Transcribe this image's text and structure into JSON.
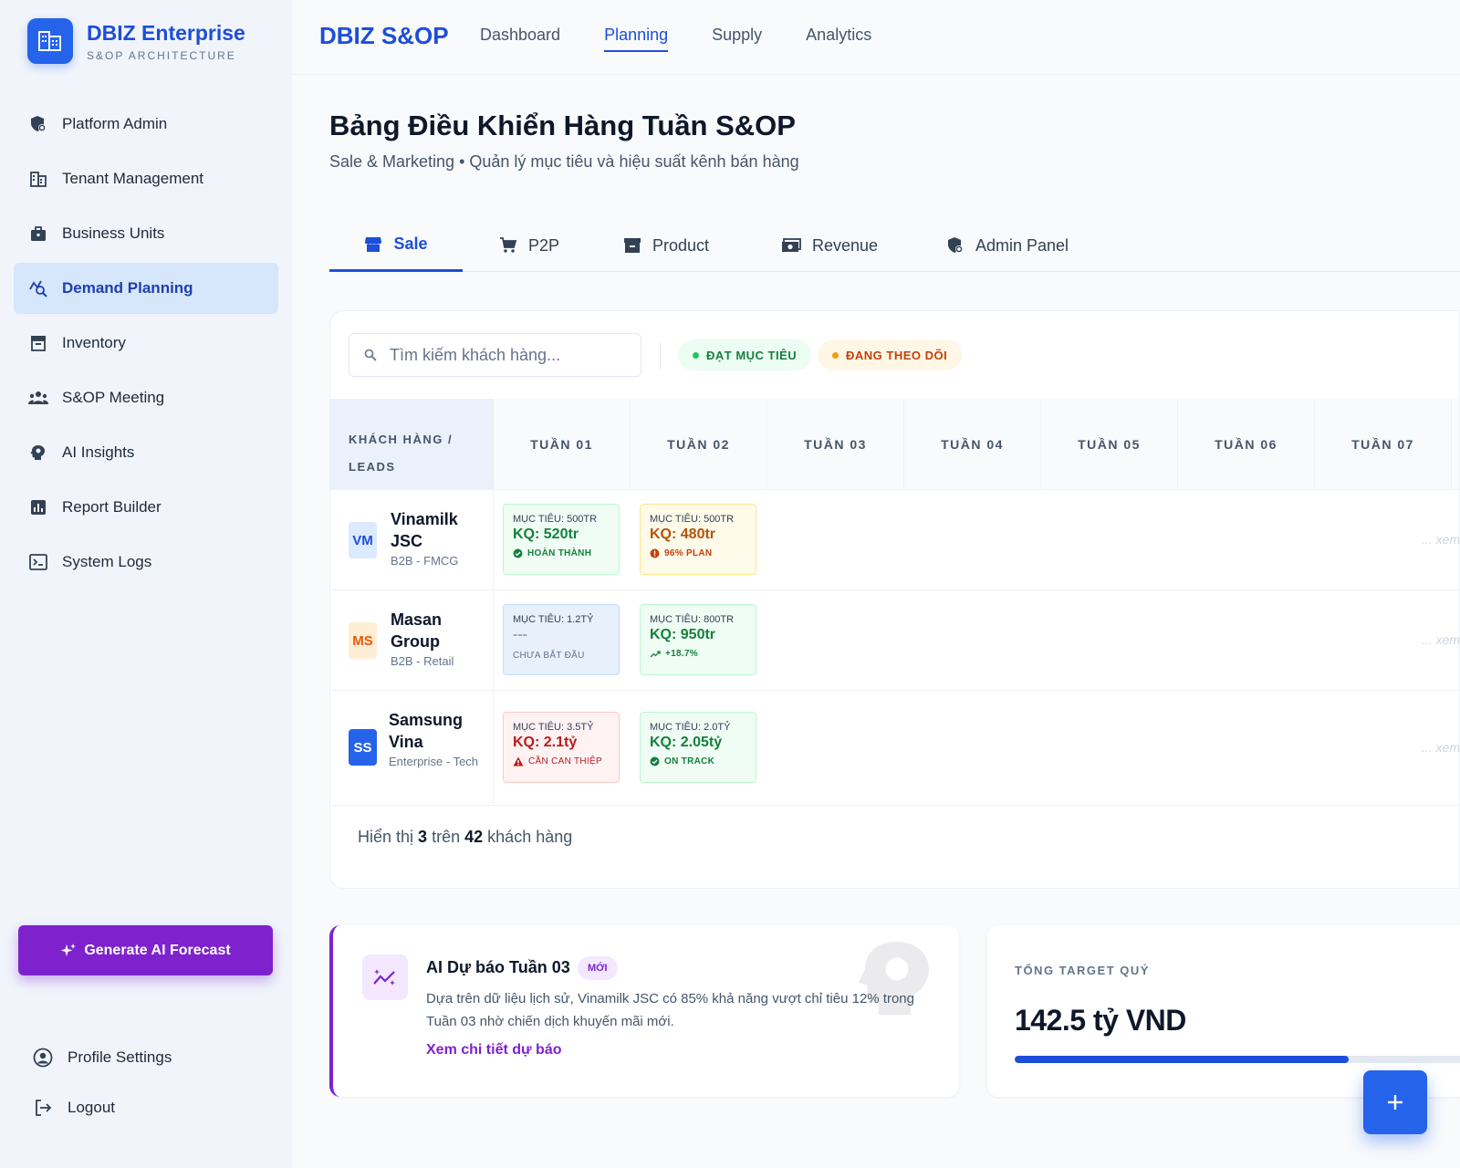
{
  "brand": {
    "title": "DBIZ Enterprise",
    "subtitle": "S&OP ARCHITECTURE"
  },
  "sidebar": {
    "items": [
      {
        "label": "Platform Admin",
        "icon": "shield-gear-icon"
      },
      {
        "label": "Tenant Management",
        "icon": "building-icon"
      },
      {
        "label": "Business Units",
        "icon": "briefcase-icon"
      },
      {
        "label": "Demand Planning",
        "icon": "chart-search-icon",
        "active": true
      },
      {
        "label": "Inventory",
        "icon": "inventory-box-icon"
      },
      {
        "label": "S&OP Meeting",
        "icon": "people-icon"
      },
      {
        "label": "AI Insights",
        "icon": "brain-icon"
      },
      {
        "label": "Report Builder",
        "icon": "bar-chart-icon"
      },
      {
        "label": "System Logs",
        "icon": "terminal-icon"
      }
    ],
    "generate_label": "Generate AI Forecast",
    "profile_label": "Profile Settings",
    "logout_label": "Logout"
  },
  "topbar": {
    "brand": "DBIZ S&OP",
    "links": [
      "Dashboard",
      "Planning",
      "Supply",
      "Analytics"
    ],
    "active": "Planning"
  },
  "page": {
    "title": "Bảng Điều Khiển Hàng Tuần S&OP",
    "subtitle": "Sale & Marketing • Quản lý mục tiêu và hiệu suất kênh bán hàng"
  },
  "tabs": [
    {
      "label": "Sale",
      "icon": "storefront-icon",
      "active": true
    },
    {
      "label": "P2P",
      "icon": "cart-icon"
    },
    {
      "label": "Product",
      "icon": "archive-icon"
    },
    {
      "label": "Revenue",
      "icon": "money-icon"
    },
    {
      "label": "Admin Panel",
      "icon": "shield-gear-icon"
    }
  ],
  "filters": {
    "search_placeholder": "Tìm kiếm khách hàng...",
    "chip_achieved": "ĐẠT MỤC TIÊU",
    "chip_tracking": "ĐANG THEO DÕI"
  },
  "table": {
    "first_header_line1": "KHÁCH HÀNG /",
    "first_header_line2": "LEADS",
    "weeks": [
      "TUẦN 01",
      "TUẦN 02",
      "TUẦN 03",
      "TUẦN 04",
      "TUẦN 05",
      "TUẦN 06",
      "TUẦN 07"
    ],
    "more_label": "... xem",
    "rows": [
      {
        "initials": "VM",
        "name": "Vinamilk JSC",
        "type": "B2B - FMCG",
        "avatar_bg": "#dbeafe",
        "avatar_fg": "#1d4ed8",
        "cells": [
          {
            "target": "MỤC TIÊU: 500TR",
            "result": "KQ: 520tr",
            "status": "HOÀN THÀNH",
            "tone": "green",
            "status_icon": "check-circle-icon"
          },
          {
            "target": "MỤC TIÊU: 500TR",
            "result": "KQ: 480tr",
            "status": "96% PLAN",
            "tone": "orange",
            "status_icon": "alert-circle-icon"
          }
        ]
      },
      {
        "initials": "MS",
        "name": "Masan Group",
        "type": "B2B - Retail",
        "avatar_bg": "#ffedd5",
        "avatar_fg": "#ea580c",
        "cells": [
          {
            "target": "MỤC TIÊU: 1.2TỶ",
            "result": "---",
            "status": "CHƯA BẮT ĐẦU",
            "tone": "blue",
            "status_icon": ""
          },
          {
            "target": "MỤC TIÊU: 800TR",
            "result": "KQ: 950tr",
            "status": "+18.7%",
            "tone": "green",
            "status_icon": "trend-up-icon"
          }
        ]
      },
      {
        "initials": "SS",
        "name": "Samsung Vina",
        "type": "Enterprise - Tech",
        "avatar_bg": "#2563eb",
        "avatar_fg": "#ffffff",
        "cells": [
          {
            "target": "MỤC TIÊU: 3.5TỶ",
            "result": "KQ: 2.1tỷ",
            "status": "CẦN CAN THIỆP",
            "tone": "red",
            "status_icon": "warning-icon"
          },
          {
            "target": "MỤC TIÊU: 2.0TỶ",
            "result": "KQ: 2.05tỷ",
            "status": "ON TRACK",
            "tone": "green",
            "status_icon": "verified-icon"
          }
        ]
      }
    ],
    "footer": {
      "prefix": "Hiển thị",
      "shown": "3",
      "middle": "trên",
      "total": "42",
      "suffix": "khách hàng"
    }
  },
  "ai_card": {
    "title": "AI Dự báo Tuần 03",
    "badge": "MỚI",
    "description": "Dựa trên dữ liệu lịch sử, Vinamilk JSC có 85% khả năng vượt chỉ tiêu 12% trong Tuần 03 nhờ chiến dịch khuyến mãi mới.",
    "link": "Xem chi tiết dự báo"
  },
  "target_card": {
    "label": "TỔNG TARGET QUÝ",
    "value": "142.5 tỷ VND",
    "progress": 0.75
  },
  "fab_label": "+",
  "colors": {
    "accent": "#1d4ed8",
    "ai": "#7e22ce",
    "success": "#15803d",
    "warning": "#c2410c",
    "danger": "#b91c1c"
  }
}
